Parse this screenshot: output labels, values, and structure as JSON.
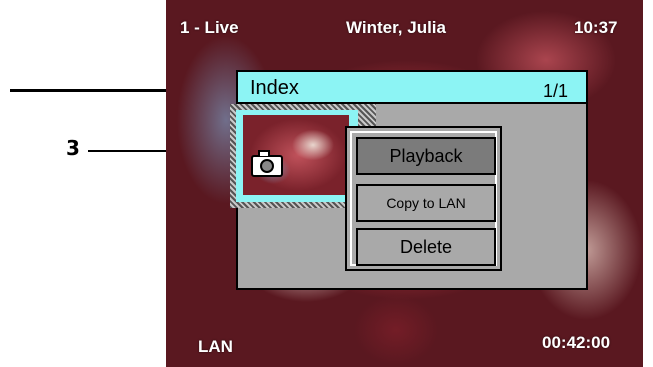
{
  "status_bar": {
    "channel": "1 - Live",
    "patient": "Winter, Julia",
    "time": "10:37",
    "network": "LAN",
    "elapsed": "00:42:00"
  },
  "dialog": {
    "title": "Index",
    "count": "1/1"
  },
  "thumbnail": {
    "type_icon": "camera-icon"
  },
  "context_menu": {
    "items": [
      {
        "label": "Playback",
        "selected": true
      },
      {
        "label": "Copy to LAN",
        "selected": false
      },
      {
        "label": "Delete",
        "selected": false
      }
    ]
  },
  "annotations": {
    "callout_number": "3"
  },
  "colors": {
    "header_cyan": "#8cf4f4",
    "panel_gray": "#a9a9a9",
    "selected_gray": "#7b7b7b"
  }
}
